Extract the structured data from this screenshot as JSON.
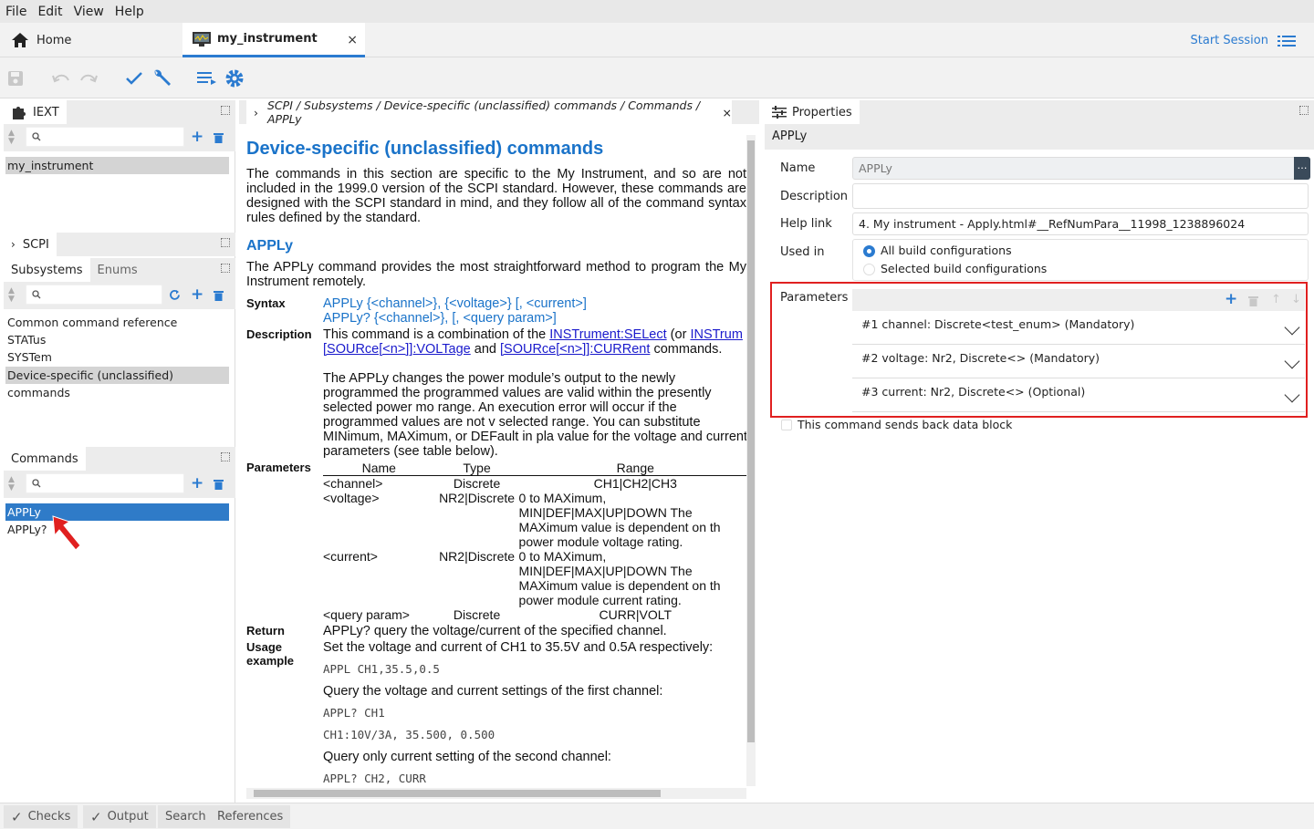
{
  "menu": {
    "file": "File",
    "edit": "Edit",
    "view": "View",
    "help": "Help"
  },
  "tabs": {
    "home": "Home",
    "instrument": "my_instrument",
    "close": "×"
  },
  "start_session": "Start Session",
  "iext": {
    "title": "IEXT",
    "items": [
      "my_instrument"
    ]
  },
  "scpi": {
    "title": "SCPI",
    "tabs": [
      "Subsystems",
      "Enums"
    ],
    "items": [
      "Common command reference",
      "STATus",
      "SYSTem",
      "Device-specific (unclassified) commands"
    ]
  },
  "commands": {
    "title": "Commands",
    "items": [
      "APPLy",
      "APPLy?"
    ]
  },
  "breadcrumb": "SCPI / Subsystems / Device-specific (unclassified) commands / Commands / APPLy",
  "doc": {
    "h1": "Device-specific (unclassified) commands",
    "intro": "The commands in this section are specific to the My Instrument, and so are not included in the 1999.0 version of the SCPI standard. However, these commands are designed with the SCPI standard in mind, and they follow all of the command syntax rules defined by the standard.",
    "h2": "APPLy",
    "summary": "The APPLy command provides the most straightforward method to program the My Instrument remotely.",
    "syntax_label": "Syntax",
    "syntax1": "APPLy {<channel>}, {<voltage>} [, <current>]",
    "syntax2": "APPLy? {<channel>}, [, <query param>]",
    "desc_label": "Description",
    "desc_a": "This command is a combination of the",
    "desc_link1": "INSTrument:SELect",
    "desc_b": "(or",
    "desc_link2": "INSTrum",
    "desc_link3": "[SOURce[<n>]]:VOLTage",
    "desc_c": "and",
    "desc_link4": "[SOURce[<n>]]:CURRent",
    "desc_d": "commands.",
    "desc2": "The APPLy changes the power module’s output to the newly programmed the programmed values are valid within the presently selected power mo range. An execution error will occur if the programmed values are not v selected range. You can substitute MINimum, MAXimum, or DEFault in pla value for the voltage and current parameters (see table below).",
    "params_label": "Parameters",
    "table_head": [
      "Name",
      "Type",
      "Range"
    ],
    "table_rows": [
      [
        "<channel>",
        "Discrete",
        "CH1|CH2|CH3"
      ],
      [
        "<voltage>",
        "NR2|Discrete",
        "0 to MAXimum, MIN|DEF|MAX|UP|DOWN The MAXimum value is dependent on th power module voltage rating."
      ],
      [
        "<current>",
        "NR2|Discrete",
        "0 to MAXimum, MIN|DEF|MAX|UP|DOWN The MAXimum value is dependent on th power module current rating."
      ],
      [
        "<query param>",
        "Discrete",
        "CURR|VOLT"
      ]
    ],
    "return_label": "Return",
    "return_text": "APPLy? query the voltage/current of the specified channel.",
    "usage_label": "Usage example",
    "usage_text": "Set the voltage and current of CH1 to 35.5V and 0.5A respectively:",
    "code1": "APPL CH1,35.5,0.5",
    "query1": "Query the voltage and current settings of the first channel:",
    "code2": "APPL? CH1",
    "code3": "CH1:10V/3A, 35.500, 0.500",
    "query2": "Query only current setting of the second channel:",
    "code4": "APPL? CH2, CURR"
  },
  "properties": {
    "title": "Properties",
    "heading": "APPLy",
    "name_label": "Name",
    "name_value": "APPLy",
    "desc_label": "Description",
    "desc_value": "",
    "help_label": "Help link",
    "help_value": "4. My instrument - Apply.html#__RefNumPara__11998_1238896024",
    "used_label": "Used in",
    "used_opt1": "All build configurations",
    "used_opt2": "Selected build configurations",
    "params_label": "Parameters",
    "params": [
      "#1  channel: Discrete<test_enum> (Mandatory)",
      "#2  voltage: Nr2, Discrete<> (Mandatory)",
      "#3  current: Nr2, Discrete<> (Optional)"
    ],
    "data_block_label": "This command sends back data block"
  },
  "statusbar": {
    "checks": "Checks",
    "output": "Output",
    "search": "Search",
    "references": "References"
  },
  "colors": {
    "accent": "#2b7bd0",
    "highlight_red": "#e02020",
    "selected": "#2f7bc8"
  }
}
